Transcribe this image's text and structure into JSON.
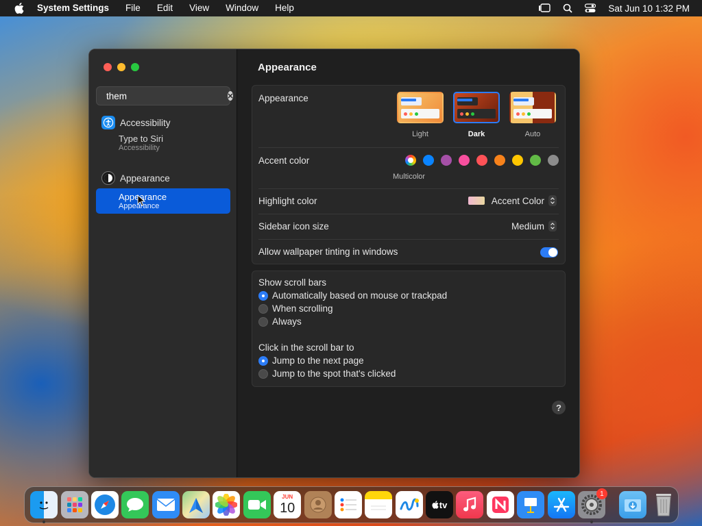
{
  "menubar": {
    "app_name": "System Settings",
    "menus": [
      "File",
      "Edit",
      "View",
      "Window",
      "Help"
    ],
    "clock": "Sat Jun 10  1:32 PM"
  },
  "sidebar": {
    "search": {
      "value": "them"
    },
    "groups": [
      {
        "label": "Accessibility",
        "results": [
          {
            "title": "Type to Siri",
            "subtitle": "Accessibility"
          }
        ]
      },
      {
        "label": "Appearance",
        "results": [
          {
            "title": "Appearance",
            "subtitle": "Appearance",
            "selected": true
          }
        ]
      }
    ]
  },
  "main": {
    "title": "Appearance",
    "appearance": {
      "label": "Appearance",
      "options": [
        "Light",
        "Dark",
        "Auto"
      ],
      "selected": "Dark"
    },
    "accent": {
      "label": "Accent color",
      "caption": "Multicolor",
      "colors": [
        "#0a84ff",
        "#a550a7",
        "#f74f9e",
        "#ff5257",
        "#f7821b",
        "#ffc600",
        "#62ba46",
        "#8c8c8c"
      ]
    },
    "highlight": {
      "label": "Highlight color",
      "value": "Accent Color"
    },
    "sidebar_icon": {
      "label": "Sidebar icon size",
      "value": "Medium"
    },
    "tinting": {
      "label": "Allow wallpaper tinting in windows",
      "on": true
    },
    "scroll_bars": {
      "label": "Show scroll bars",
      "options": [
        "Automatically based on mouse or trackpad",
        "When scrolling",
        "Always"
      ],
      "selected_index": 0
    },
    "click_scroll": {
      "label": "Click in the scroll bar to",
      "options": [
        "Jump to the next page",
        "Jump to the spot that's clicked"
      ],
      "selected_index": 0
    },
    "help_label": "?"
  },
  "dock": {
    "calendar_month": "JUN",
    "calendar_day": "10",
    "tv_label": "tv",
    "settings_badge": "1"
  },
  "colors": {
    "accent": "#2c7cf6",
    "selection": "#0a5bd9"
  }
}
